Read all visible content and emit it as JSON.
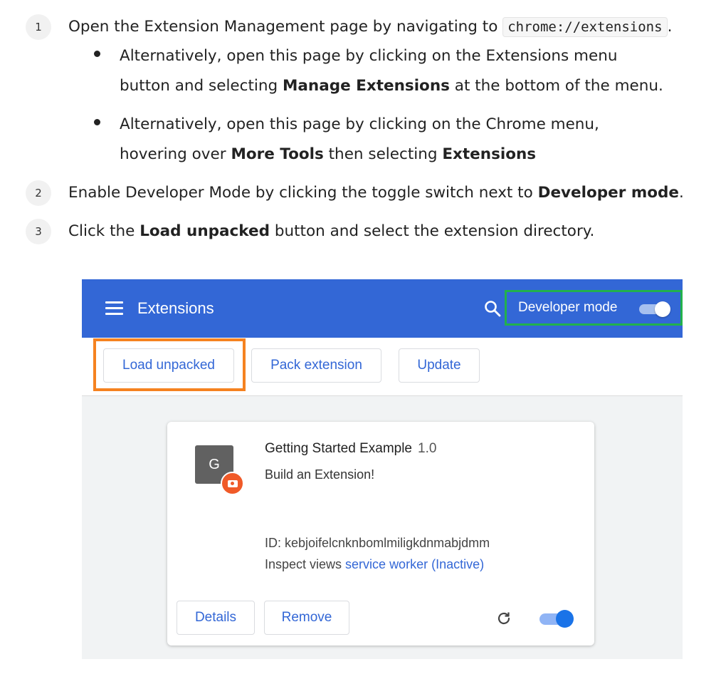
{
  "steps": [
    {
      "number": "1",
      "text_before": "Open the Extension Management page by navigating to ",
      "code": "chrome://extensions",
      "text_after": "."
    },
    {
      "number": "2",
      "text_before": "Enable Developer Mode by clicking the toggle switch next to ",
      "bold": "Developer mode",
      "text_after": "."
    },
    {
      "number": "3",
      "text_before": "Click the ",
      "bold": "Load unpacked",
      "text_after": " button and select the extension directory."
    }
  ],
  "bullets": [
    {
      "line1": "Alternatively, open this page by clicking on the Extensions menu",
      "line2_before": "button and selecting ",
      "line2_bold": "Manage Extensions",
      "line2_after": " at the bottom of the menu."
    },
    {
      "line1": "Alternatively, open this page by clicking on the Chrome menu,",
      "line2_before": "hovering over ",
      "line2_bold": "More Tools",
      "line2_mid": " then selecting ",
      "line2_bold2": "Extensions"
    }
  ],
  "screenshot": {
    "header": {
      "title": "Extensions",
      "dev_mode_label": "Developer mode",
      "dev_mode_on": true
    },
    "toolbar": {
      "load_unpacked": "Load unpacked",
      "pack_extension": "Pack extension",
      "update": "Update"
    },
    "card": {
      "icon_letter": "G",
      "name": "Getting Started Example",
      "version": "1.0",
      "description": "Build an Extension!",
      "id_text": "ID: kebjoifelcnknbomlmiligkdnmabjdmm",
      "inspect_prefix": "Inspect views ",
      "inspect_link": "service worker (Inactive)",
      "details": "Details",
      "remove": "Remove",
      "enabled": true
    },
    "colors": {
      "header_bg": "#3367d6",
      "dev_mode_highlight": "#22b14c",
      "load_unpacked_highlight": "#f58220",
      "link": "#3367d6"
    }
  }
}
